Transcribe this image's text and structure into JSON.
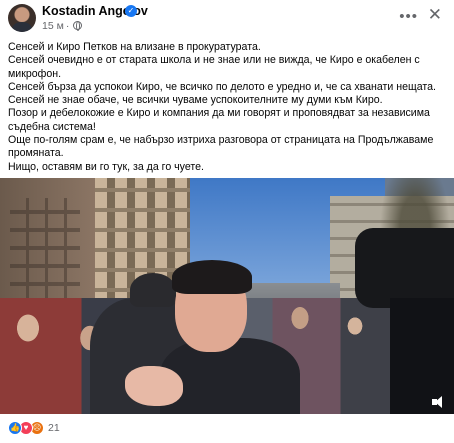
{
  "post": {
    "author": "Kostadin Angelov",
    "time": "15 м",
    "paragraphs": [
      "Сенсей и Киро Петков на влизане в прокуратурата.",
      "Сенсей очевидно е от старата школа и не знае или не вижда, че Киро е окабелен с микрофон.",
      "Сенсей бърза да успокои Киро, че всичко по делото е уредно и, че са хванати нещата.",
      "Сенсей не знае обаче, че всички чуваме успокоителните му думи към Киро.",
      "Позор и дебелокожие е Киро и компания да ми говорят и проповядват за независима съдебна система!",
      "Още по-голям срам е, че набързо изтриха разговора от  страницата на Продължаваме промяната.",
      "Нищо, оставям ви го тук, за да го чуете."
    ]
  },
  "icons": {
    "verified": "verified-badge-icon",
    "audience": "globe-icon",
    "more": "more-options-icon",
    "close": "close-icon",
    "volume": "volume-icon"
  },
  "reactions": {
    "types": [
      "like",
      "love",
      "angry"
    ],
    "count": "21"
  },
  "colors": {
    "accent": "#1877f2",
    "secondary_text": "#65676b"
  }
}
